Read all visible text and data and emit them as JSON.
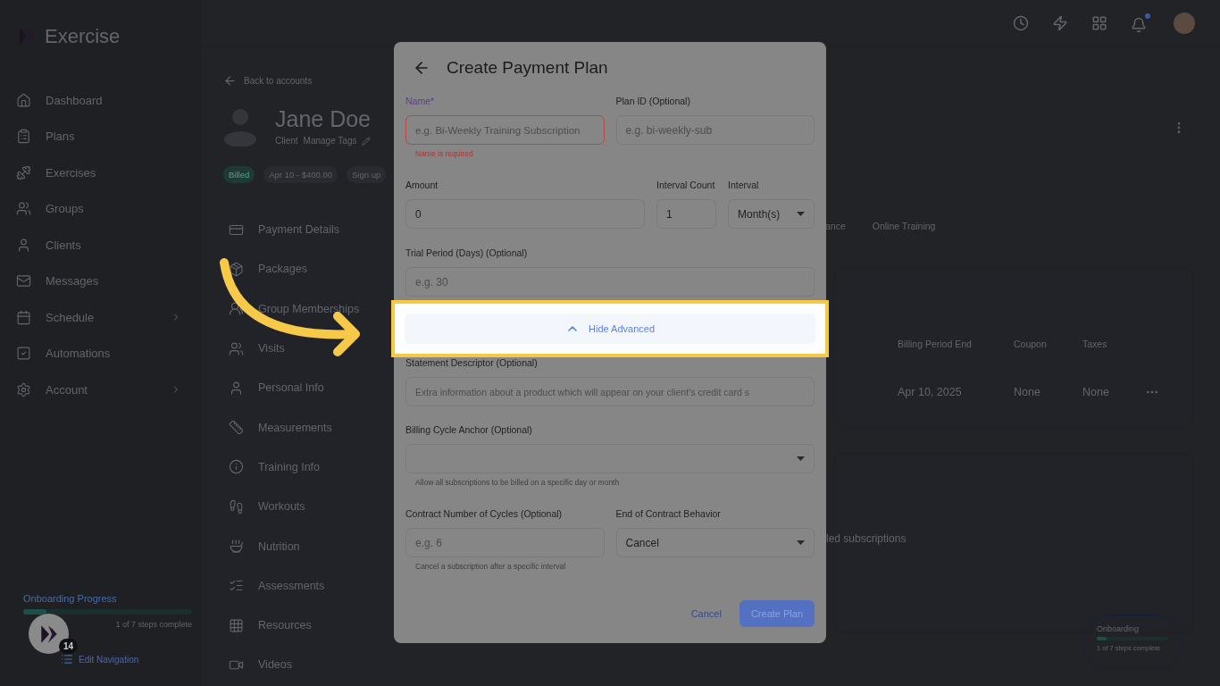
{
  "sidebar": {
    "brand": "Exercise",
    "items": [
      {
        "label": "Dashboard",
        "has_submenu": false
      },
      {
        "label": "Plans",
        "has_submenu": false
      },
      {
        "label": "Exercises",
        "has_submenu": false
      },
      {
        "label": "Groups",
        "has_submenu": false
      },
      {
        "label": "Clients",
        "has_submenu": false
      },
      {
        "label": "Messages",
        "has_submenu": false
      },
      {
        "label": "Schedule",
        "has_submenu": true
      },
      {
        "label": "Automations",
        "has_submenu": false
      },
      {
        "label": "Account",
        "has_submenu": true
      }
    ],
    "onboarding": {
      "title": "Onboarding Progress",
      "level": 0.14,
      "caption": "1 of 7 steps complete"
    },
    "helper_badge": {
      "count": "14"
    },
    "edit_navigation": "Edit Navigation"
  },
  "topbar": {
    "notification_dot": true
  },
  "profile": {
    "back_link": "Back to accounts",
    "name": "Jane Doe",
    "role": "Client",
    "manage_tags": "Manage Tags",
    "chips": [
      {
        "label": "Billed",
        "kind": "status"
      },
      {
        "label": "Apr 10 - $400.00",
        "kind": "plain"
      },
      {
        "label": "Sign up",
        "kind": "plain"
      }
    ]
  },
  "profile_menu": [
    {
      "label": "Payment Details"
    },
    {
      "label": "Packages"
    },
    {
      "label": "Group Memberships"
    },
    {
      "label": "Visits"
    },
    {
      "label": "Personal Info"
    },
    {
      "label": "Measurements"
    },
    {
      "label": "Training Info"
    },
    {
      "label": "Workouts"
    },
    {
      "label": "Nutrition"
    },
    {
      "label": "Assessments"
    },
    {
      "label": "Resources"
    },
    {
      "label": "Videos"
    }
  ],
  "tabs": [
    {
      "label": "ance"
    },
    {
      "label": "Online Training"
    }
  ],
  "subscriptions_table": {
    "columns": [
      "Billing Period End",
      "Coupon",
      "Taxes"
    ],
    "rows": [
      [
        "Apr 10, 2025",
        "None",
        "None"
      ]
    ]
  },
  "empty_note": "led subscriptions",
  "onboarding_widget": {
    "title": "Onboarding",
    "level": 0.14,
    "caption": "1 of 7 steps complete"
  },
  "modal": {
    "title": "Create Payment Plan",
    "name": {
      "label": "Name*",
      "placeholder": "e.g. Bi-Weekly Training Subscription",
      "error": "Name is required"
    },
    "plan_id": {
      "label": "Plan ID (Optional)",
      "placeholder": "e.g. bi-weekly-sub"
    },
    "amount": {
      "label": "Amount",
      "value": "0"
    },
    "interval_count": {
      "label": "Interval Count",
      "value": "1"
    },
    "interval": {
      "label": "Interval",
      "value": "Month(s)"
    },
    "trial_period": {
      "label": "Trial Period (Days) (Optional)",
      "placeholder": "e.g. 30"
    },
    "advanced_toggle": {
      "label": "Hide Advanced",
      "expanded": true,
      "highlighted": true
    },
    "statement_descriptor": {
      "label": "Statement Descriptor (Optional)",
      "placeholder": "Extra information about a product which will appear on your client's credit card s"
    },
    "billing_cycle_anchor": {
      "label": "Billing Cycle Anchor (Optional)",
      "helper": "Allow all subscriptions to be billed on a specific day or month"
    },
    "contract_cycles": {
      "label": "Contract Number of Cycles (Optional)",
      "placeholder": "e.g. 6",
      "helper": "Cancel a subscription after a specific interval"
    },
    "end_behavior": {
      "label": "End of Contract Behavior",
      "value": "Cancel"
    },
    "buttons": {
      "cancel": "Cancel",
      "submit": "Create Plan"
    }
  }
}
